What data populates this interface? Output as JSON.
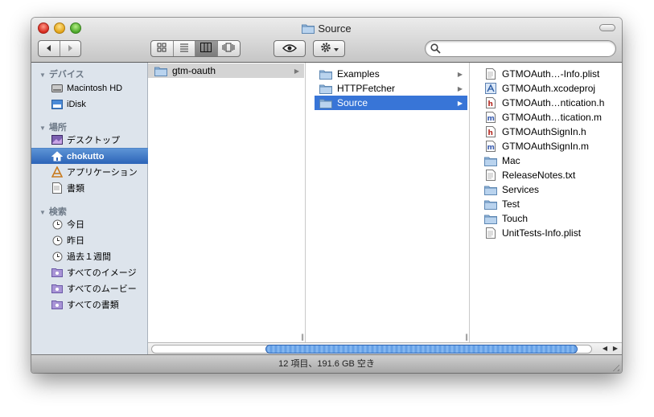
{
  "window": {
    "title": "Source"
  },
  "toolbar": {
    "back_icon": "back-arrow-icon",
    "forward_icon": "forward-arrow-icon",
    "view_modes": [
      {
        "name": "icon-view",
        "icon": "icon-view-icon",
        "active": false
      },
      {
        "name": "list-view",
        "icon": "list-view-icon",
        "active": false
      },
      {
        "name": "column-view",
        "icon": "column-view-icon",
        "active": true
      },
      {
        "name": "coverflow-view",
        "icon": "coverflow-view-icon",
        "active": false
      }
    ],
    "quicklook_icon": "eye-icon",
    "action_icon": "gear-icon",
    "search": {
      "placeholder": "",
      "value": ""
    }
  },
  "sidebar": {
    "devices": {
      "header": "デバイス",
      "items": [
        {
          "label": "Macintosh HD",
          "icon": "harddisk-icon"
        },
        {
          "label": "iDisk",
          "icon": "idisk-icon"
        }
      ]
    },
    "places": {
      "header": "場所",
      "items": [
        {
          "label": "デスクトップ",
          "icon": "desktop-icon"
        },
        {
          "label": "chokutto",
          "icon": "home-icon",
          "selected": true
        },
        {
          "label": "アプリケーション",
          "icon": "applications-icon"
        },
        {
          "label": "書類",
          "icon": "documents-icon"
        }
      ]
    },
    "search_for": {
      "header": "検索",
      "items": [
        {
          "label": "今日",
          "icon": "clock-icon"
        },
        {
          "label": "昨日",
          "icon": "clock-icon"
        },
        {
          "label": "過去１週間",
          "icon": "clock-icon"
        },
        {
          "label": "すべてのイメージ",
          "icon": "smart-folder-icon"
        },
        {
          "label": "すべてのムービー",
          "icon": "smart-folder-icon"
        },
        {
          "label": "すべての書類",
          "icon": "smart-folder-icon"
        }
      ]
    }
  },
  "columns": [
    {
      "items": [
        {
          "label": "gtm-oauth",
          "type": "folder",
          "has_children": true,
          "selected": "inactive"
        }
      ]
    },
    {
      "items": [
        {
          "label": "Examples",
          "type": "folder",
          "has_children": true
        },
        {
          "label": "HTTPFetcher",
          "type": "folder",
          "has_children": true
        },
        {
          "label": "Source",
          "type": "folder",
          "has_children": true,
          "selected": "active"
        }
      ]
    },
    {
      "items": [
        {
          "label": "GTMOAuth…-Info.plist",
          "type": "plist"
        },
        {
          "label": "GTMOAuth.xcodeproj",
          "type": "xcodeproj"
        },
        {
          "label": "GTMOAuth…ntication.h",
          "type": "h"
        },
        {
          "label": "GTMOAuth…tication.m",
          "type": "m"
        },
        {
          "label": "GTMOAuthSignIn.h",
          "type": "h"
        },
        {
          "label": "GTMOAuthSignIn.m",
          "type": "m"
        },
        {
          "label": "Mac",
          "type": "folder"
        },
        {
          "label": "ReleaseNotes.txt",
          "type": "txt"
        },
        {
          "label": "Services",
          "type": "folder"
        },
        {
          "label": "Test",
          "type": "folder"
        },
        {
          "label": "Touch",
          "type": "folder"
        },
        {
          "label": "UnitTests-Info.plist",
          "type": "plist"
        }
      ]
    }
  ],
  "status": {
    "text": "12 項目、191.6 GB 空き"
  }
}
